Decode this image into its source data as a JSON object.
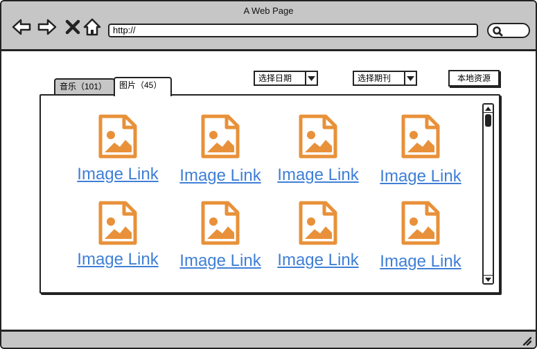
{
  "window": {
    "title": "A Web Page"
  },
  "toolbar": {
    "back_icon": "back-arrow-icon",
    "forward_icon": "forward-arrow-icon",
    "stop_icon": "close-icon",
    "home_icon": "home-icon",
    "address_value": "http://",
    "search_icon": "search-icon"
  },
  "tabs": [
    {
      "label": "音乐（101）",
      "selected": false
    },
    {
      "label": "图片（45）",
      "selected": true
    }
  ],
  "filters": {
    "date_select": "选择日期",
    "issue_select": "选择期刊",
    "local_button": "本地资源"
  },
  "items": [
    {
      "label": "Image Link",
      "icon": "image-file-icon"
    },
    {
      "label": "Image Link",
      "icon": "image-file-icon"
    },
    {
      "label": "Image Link",
      "icon": "image-file-icon"
    },
    {
      "label": "Image Link",
      "icon": "image-file-icon"
    },
    {
      "label": "Image Link",
      "icon": "image-file-icon"
    },
    {
      "label": "Image Link",
      "icon": "image-file-icon"
    },
    {
      "label": "Image Link",
      "icon": "image-file-icon"
    },
    {
      "label": "Image Link",
      "icon": "image-file-icon"
    }
  ],
  "colors": {
    "chrome": "#c6c6c6",
    "link": "#3f7fd6",
    "icon_accent": "#e8913a"
  }
}
